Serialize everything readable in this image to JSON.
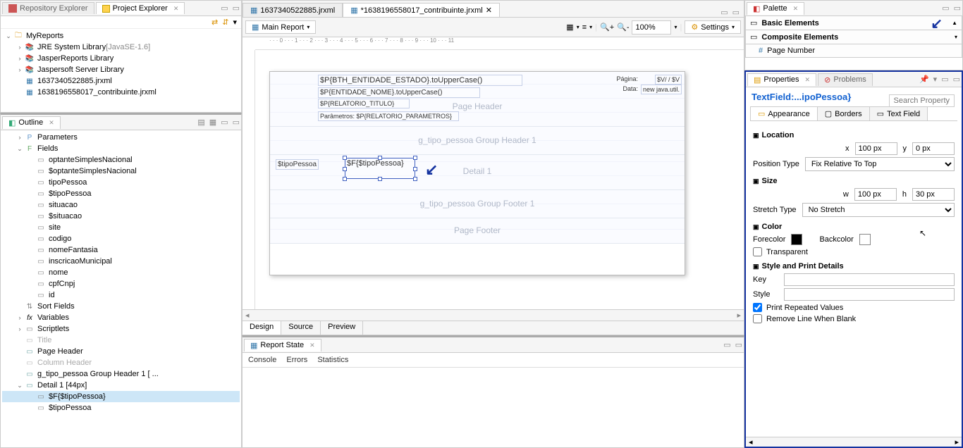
{
  "leftTop": {
    "tabs": [
      {
        "label": "Repository Explorer",
        "active": false
      },
      {
        "label": "Project Explorer",
        "active": true
      }
    ],
    "tree": [
      {
        "label": "MyReports",
        "ind": 0,
        "expanded": true,
        "icon": "folder"
      },
      {
        "label": "JRE System Library",
        "suffix": " [JavaSE-1.6]",
        "ind": 1,
        "icon": "lib"
      },
      {
        "label": "JasperReports Library",
        "ind": 1,
        "icon": "lib"
      },
      {
        "label": "Jaspersoft Server Library",
        "ind": 1,
        "icon": "lib"
      },
      {
        "label": "1637340522885.jrxml",
        "ind": 1,
        "icon": "jr"
      },
      {
        "label": "1638196558017_contribuinte.jrxml",
        "ind": 1,
        "icon": "jr",
        "cutoff": true
      }
    ]
  },
  "outline": {
    "title": "Outline",
    "tree": [
      {
        "label": "Parameters",
        "ind": 1,
        "icon": "p",
        "twisty": ">"
      },
      {
        "label": "Fields",
        "ind": 1,
        "icon": "f",
        "twisty": "v"
      },
      {
        "label": "optanteSimplesNacional",
        "ind": 2,
        "icon": "txt"
      },
      {
        "label": "$optanteSimplesNacional",
        "ind": 2,
        "icon": "txt"
      },
      {
        "label": "tipoPessoa",
        "ind": 2,
        "icon": "txt"
      },
      {
        "label": "$tipoPessoa",
        "ind": 2,
        "icon": "txt"
      },
      {
        "label": "situacao",
        "ind": 2,
        "icon": "txt"
      },
      {
        "label": "$situacao",
        "ind": 2,
        "icon": "txt"
      },
      {
        "label": "site",
        "ind": 2,
        "icon": "txt"
      },
      {
        "label": "codigo",
        "ind": 2,
        "icon": "txt"
      },
      {
        "label": "nomeFantasia",
        "ind": 2,
        "icon": "txt"
      },
      {
        "label": "inscricaoMunicipal",
        "ind": 2,
        "icon": "txt"
      },
      {
        "label": "nome",
        "ind": 2,
        "icon": "txt"
      },
      {
        "label": "cpfCnpj",
        "ind": 2,
        "icon": "txt"
      },
      {
        "label": "id",
        "ind": 2,
        "icon": "txt"
      },
      {
        "label": "Sort Fields",
        "ind": 1,
        "icon": "sort"
      },
      {
        "label": "Variables",
        "ind": 1,
        "icon": "fx",
        "twisty": ">"
      },
      {
        "label": "Scriptlets",
        "ind": 1,
        "icon": "sc",
        "twisty": ">"
      },
      {
        "label": "Title",
        "ind": 1,
        "icon": "band",
        "dim": true
      },
      {
        "label": "Page Header",
        "ind": 1,
        "icon": "band"
      },
      {
        "label": "Column Header",
        "ind": 1,
        "icon": "band",
        "dim": true
      },
      {
        "label": "g_tipo_pessoa Group Header 1 [ ...",
        "ind": 1,
        "icon": "band"
      },
      {
        "label": "Detail 1 [44px]",
        "ind": 1,
        "icon": "band",
        "twisty": "v"
      },
      {
        "label": "$F{$tipoPessoa}",
        "ind": 2,
        "icon": "tf",
        "selected": true
      },
      {
        "label": "$tipoPessoa",
        "ind": 2,
        "icon": "txt",
        "cutoff": true
      }
    ]
  },
  "editor": {
    "tabs": [
      {
        "label": "1637340522885.jrxml",
        "active": false
      },
      {
        "label": "*1638196558017_contribuinte.jrxml",
        "active": true
      }
    ],
    "mainReport": "Main Report",
    "zoom": "100%",
    "settings": "Settings",
    "bottomTabs": [
      "Design",
      "Source",
      "Preview"
    ],
    "headerLines": {
      "l1": "$P{BTH_ENTIDADE_ESTADO}.toUpperCase()",
      "l2": "$P{ENTIDADE_NOME}.toUpperCase()",
      "l3": "$P{RELATORIO_TITULO}",
      "l4": "Parâmetros: $P{RELATORIO_PARAMETROS}",
      "paginaLabel": "Página:",
      "paginaVal": "$V/   / $V",
      "dataLabel": "Data:",
      "dataVal": "new java.util."
    },
    "bandLabels": {
      "pageHeader": "Page Header",
      "groupHeader": "g_tipo_pessoa Group Header 1",
      "detail": "Detail 1",
      "groupFooter": "g_tipo_pessoa Group Footer 1",
      "pageFooter": "Page Footer"
    },
    "detail": {
      "static": "$tipoPessoa",
      "field": "$F{$tipoPessoa}"
    }
  },
  "reportState": {
    "title": "Report State",
    "tabs": [
      "Console",
      "Errors",
      "Statistics"
    ]
  },
  "palette": {
    "title": "Palette",
    "groups": [
      "Basic Elements",
      "Composite Elements"
    ],
    "item": "Page Number"
  },
  "properties": {
    "tabTitle": "Properties",
    "problemsTab": "Problems",
    "breadcrumb": "TextField:...ipoPessoa}",
    "searchPlaceholder": "Search Property",
    "tabs": [
      "Appearance",
      "Borders",
      "Text Field"
    ],
    "location": {
      "title": "Location",
      "x": "100 px",
      "y": "0 px",
      "positionTypeLabel": "Position Type",
      "positionType": "Fix Relative To Top"
    },
    "size": {
      "title": "Size",
      "w": "100 px",
      "h": "30 px",
      "stretchTypeLabel": "Stretch Type",
      "stretchType": "No Stretch"
    },
    "color": {
      "title": "Color",
      "forecolorLabel": "Forecolor",
      "backcolorLabel": "Backcolor",
      "transparentLabel": "Transparent"
    },
    "style": {
      "title": "Style and Print Details",
      "keyLabel": "Key",
      "styleLabel": "Style",
      "printRepeated": "Print Repeated Values",
      "removeBlank": "Remove Line When Blank"
    }
  }
}
